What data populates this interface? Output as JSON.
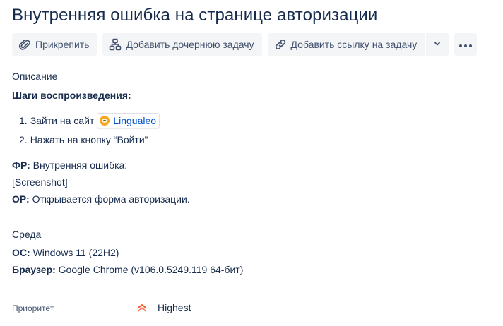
{
  "issue": {
    "title": "Внутренняя ошибка на странице авторизации"
  },
  "toolbar": {
    "attach_label": "Прикрепить",
    "child_issue_label": "Добавить дочернюю задачу",
    "link_issue_label": "Добавить ссылку на задачу"
  },
  "description": {
    "heading": "Описание",
    "steps_heading": "Шаги воспроизведения:",
    "steps": [
      {
        "number": "1.",
        "text": "Зайти на сайт",
        "link_label": "Lingualeo"
      },
      {
        "number": "2.",
        "text": "Нажать на кнопку “Войти”"
      }
    ],
    "actual_key": "ФР:",
    "actual_value": "Внутренняя ошибка:",
    "screenshot_placeholder": "[Screenshot]",
    "expected_key": "ОР:",
    "expected_value": "Открывается форма авторизации."
  },
  "environment": {
    "heading": "Среда",
    "os_key": "ОС:",
    "os_value": "Windows 11 (22H2)",
    "browser_key": "Браузер:",
    "browser_value": "Google Chrome (v106.0.5249.119 64-бит)"
  },
  "priority": {
    "label": "Приоритет",
    "value": "Highest",
    "icon": "priority-highest-icon",
    "icon_color": "#ff5630"
  },
  "colors": {
    "text": "#172b4d",
    "button_bg": "#f4f5f7",
    "link": "#0052cc"
  }
}
